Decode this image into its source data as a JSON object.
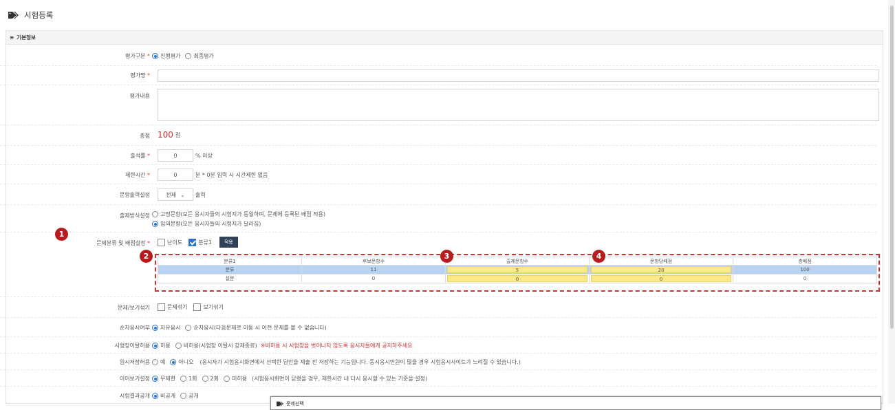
{
  "page": {
    "title": "시험등록",
    "tag_icon": "tag-icon"
  },
  "panel": {
    "title": "기본정보",
    "menu_icon": "list-icon"
  },
  "fields": {
    "eval_type": {
      "label": "평가구분",
      "required": "*",
      "options": [
        "진행평가",
        "최종평가"
      ],
      "selected": "진행평가"
    },
    "eval_name": {
      "label": "평가명",
      "required": "*",
      "value": ""
    },
    "eval_content": {
      "label": "평가내용",
      "value": ""
    },
    "total": {
      "label": "총점",
      "value": "100",
      "unit": "점"
    },
    "attendance": {
      "label": "출석률",
      "required": "*",
      "value": "0",
      "suffix": "% 이상"
    },
    "time_limit": {
      "label": "제한시간",
      "required": "*",
      "value": "0",
      "suffix": "분 * 0분 입력 시 시간제한 없음"
    },
    "output": {
      "label": "문항출력설정",
      "value": "전체",
      "suffix": "출력"
    },
    "method": {
      "label": "출제방식설정",
      "options": [
        "고정문항(모든 응시자들의 시험지가 동일하며, 문제에 등록된 배점 적용)",
        "임의문항(모든 응시자들의 시험지가 달라짐)"
      ],
      "selected": "임의문항(모든 응시자들의 시험지가 달라짐)"
    },
    "category": {
      "label": "문제분류 및 배점설정",
      "required": "*",
      "checks": [
        {
          "label": "난이도",
          "checked": false
        },
        {
          "label": "분류1",
          "checked": true
        }
      ],
      "apply_label": "적용",
      "table": {
        "headers": [
          "분류1",
          "후보문항수",
          "출제문항수",
          "문항당배점",
          "총배점"
        ],
        "rows": [
          [
            "분류",
            "11",
            "5",
            "20",
            "100"
          ],
          [
            "설문",
            "0",
            "0",
            "0",
            "0"
          ]
        ]
      }
    },
    "shuffle": {
      "label": "문제/보기섞기",
      "checks": [
        "문제섞기",
        "보기섞기"
      ]
    },
    "order": {
      "label": "순차응시여부",
      "options": [
        "자유응시",
        "순차응시(다음문제로 이동 시 이전 문제를 볼 수 없습니다)"
      ],
      "selected": "자유응시"
    },
    "leave": {
      "label": "시험장이탈허용",
      "options": [
        "허용",
        "비허용(시험장 이탈시 강제종료)"
      ],
      "selected": "허용",
      "warning": "※비허용 시 시험창을 벗어나지 않도록 응시자들에게 공지하주세요"
    },
    "temp_save": {
      "label": "임시저장허용",
      "options": [
        "예",
        "아니오"
      ],
      "selected": "아니오",
      "note": "(응시자가 시험응시화면에서 선택한 답안을 제출 전 저장하는 기능입니다. 동시응시인원이 많을 경우 시험응시사이트가 느려질 수 있습니다.)"
    },
    "resume": {
      "label": "이어보기설정",
      "options": [
        "무제한",
        "1회",
        "2회",
        "미허용"
      ],
      "selected": "무제한",
      "note": "(시험응시화면이 닫혔을 경우, 제한시간 내 다시 응시할 수 있는 기준을 설정)"
    },
    "result": {
      "label": "시험결과공개",
      "options": [
        "비공개",
        "공개"
      ],
      "selected": "비공개"
    }
  },
  "badges": [
    "1",
    "2",
    "3",
    "4"
  ],
  "popup": {
    "title": "문제선택"
  },
  "colors": {
    "accent": "#2b73c8",
    "badge": "#b71c1c",
    "highlight": "#b8d3f2",
    "yellow": "#fbe98a",
    "dash": "#d32f2f",
    "total": "#d32f2f"
  }
}
